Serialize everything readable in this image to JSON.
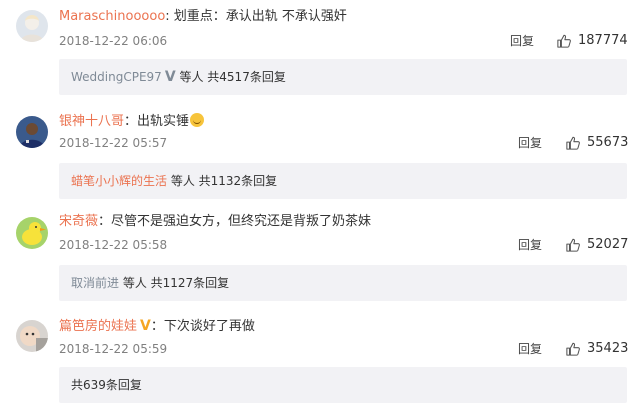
{
  "comments": [
    {
      "user": "Maraschinooooo",
      "colon": ": ",
      "text": "划重点：承认出轨 不承认强奸",
      "time": "2018-12-22 06:06",
      "reply_label": "回复",
      "likes": "187774",
      "sub": {
        "user": "WeddingCPE97",
        "badge": "V",
        "suffix": " 等人 共4517条回复"
      },
      "avatar_color": "#c9d3df"
    },
    {
      "user": "银神十八哥",
      "colon": "：",
      "text": "出轨实锤",
      "time": "2018-12-22 05:57",
      "reply_label": "回复",
      "likes": "55673",
      "sub": {
        "user": "蜡笔小小辉的生活",
        "suffix": " 等人 共1132条回复"
      },
      "avatar_color": "#1f3a73"
    },
    {
      "user": "宋奇薇",
      "colon": "：",
      "text": "尽管不是强迫女方，但终究还是背叛了奶茶妹",
      "time": "2018-12-22 05:58",
      "reply_label": "回复",
      "likes": "52027",
      "sub": {
        "user": "取消前进",
        "suffix": " 等人 共1127条回复"
      },
      "avatar_color": "#8cc63f"
    },
    {
      "user": "篇笆房的娃娃",
      "badge": "V",
      "colon": "：",
      "text": "下次谈好了再做",
      "time": "2018-12-22 05:59",
      "reply_label": "回复",
      "likes": "35423",
      "sub": {
        "suffix": "共639条回复"
      },
      "avatar_color": "#d9c9bf"
    }
  ],
  "icons": {
    "like": "thumbs-up-icon"
  },
  "colors": {
    "username": "#eb7350",
    "meta": "#808080",
    "subbox_bg": "#f2f2f5",
    "verified_gold": "#f5a623"
  }
}
